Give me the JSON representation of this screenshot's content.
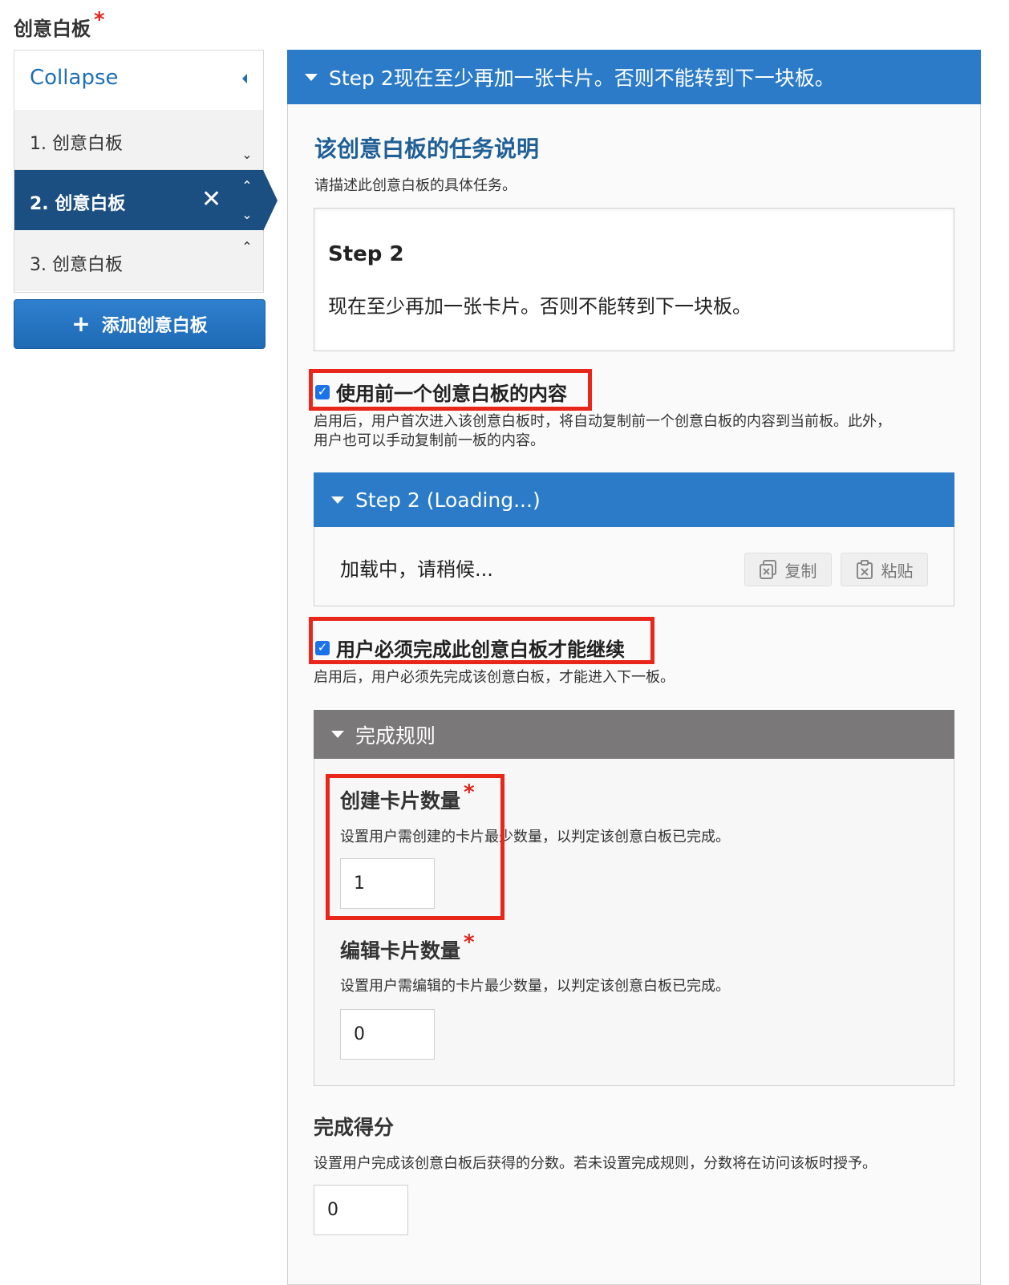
{
  "field": {
    "title": "创意白板",
    "required_mark": "*"
  },
  "sidebar": {
    "collapse_label": "Collapse",
    "boards": [
      {
        "label": "1. 创意白板"
      },
      {
        "label": "2. 创意白板"
      },
      {
        "label": "3. 创意白板"
      }
    ],
    "add_button_label": "添加创意白板"
  },
  "main": {
    "header": "Step 2现在至少再加一张卡片。否则不能转到下一块板。",
    "task_section": {
      "title": "该创意白板的任务说明",
      "description": "请描述此创意白板的具体任务。",
      "step_heading": "Step 2",
      "step_text": "现在至少再加一张卡片。否则不能转到下一块板。"
    },
    "use_previous": {
      "label": "使用前一个创意白板的内容",
      "checked": true,
      "help_line1": "启用后，用户首次进入该创意白板时，将自动复制前一个创意白板的内容到当前板。此外，",
      "help_line2": "用户也可以手动复制前一板的内容。"
    },
    "preview": {
      "header": "Step 2 (Loading...)",
      "loading_text": "加载中，请稍候...",
      "copy_label": "复制",
      "paste_label": "粘贴"
    },
    "must_complete": {
      "label": "用户必须完成此创意白板才能继续",
      "checked": true,
      "help": "启用后，用户必须先完成该创意白板，才能进入下一板。"
    },
    "rules": {
      "header": "完成规则",
      "create_cards": {
        "label": "创建卡片数量",
        "required_mark": "*",
        "help": "设置用户需创建的卡片最少数量，以判定该创意白板已完成。",
        "value": "1"
      },
      "edit_cards": {
        "label": "编辑卡片数量",
        "required_mark": "*",
        "help": "设置用户需编辑的卡片最少数量，以判定该创意白板已完成。",
        "value": "0"
      }
    },
    "score": {
      "label": "完成得分",
      "help": "设置用户完成该创意白板后获得的分数。若未设置完成规则，分数将在访问该板时授予。",
      "value": "0"
    }
  },
  "colors": {
    "brand_blue": "#2b7bc8",
    "active_navy": "#1b4f82",
    "rules_gray": "#7a7879",
    "highlight_red": "#e8271a",
    "required_red": "#e1251b"
  }
}
